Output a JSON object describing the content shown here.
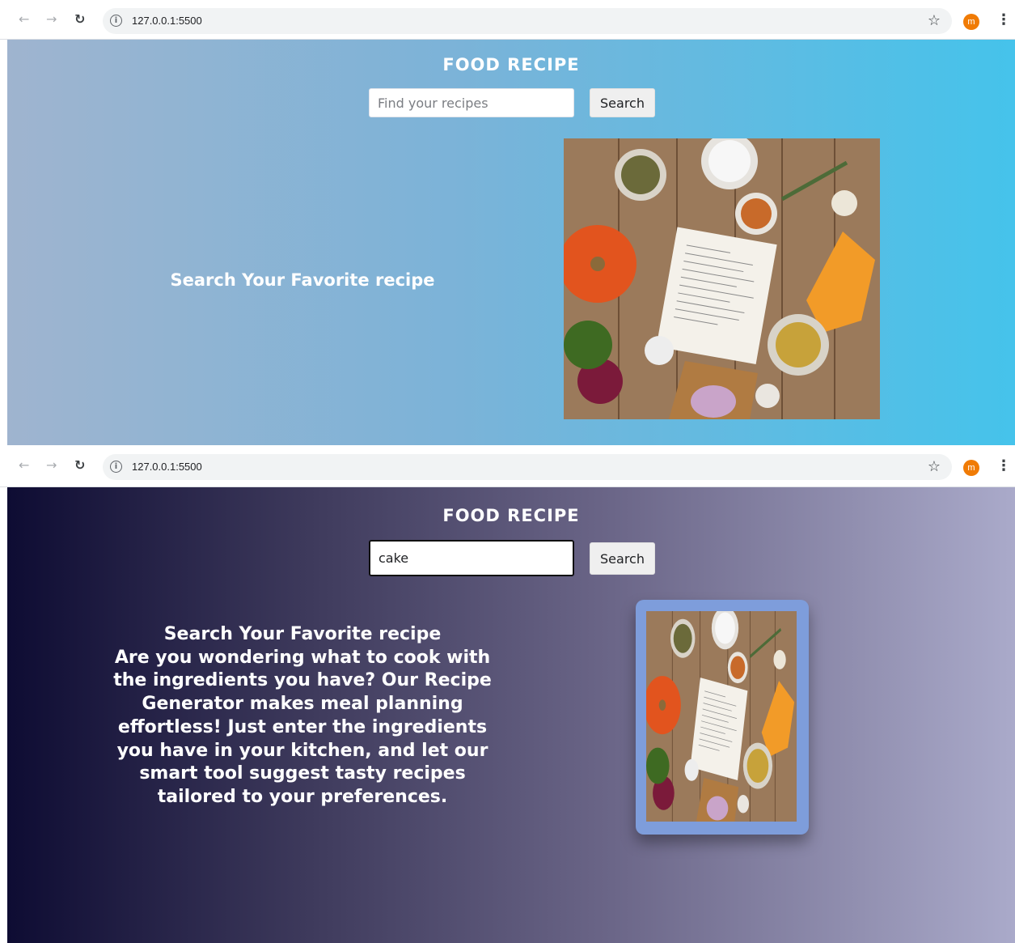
{
  "browser": {
    "url": "127.0.0.1:5500",
    "avatar_letter": "m",
    "accent_color": "#f07b05"
  },
  "screen_1": {
    "title": "FOOD RECIPE",
    "search": {
      "placeholder": "Find your recipes",
      "value": ""
    },
    "search_button": "Search",
    "heading": "Search Your Favorite recipe",
    "background_colors": [
      "#9fb4cf",
      "#45c3eb"
    ]
  },
  "screen_2": {
    "title": "FOOD RECIPE",
    "search": {
      "placeholder": "Find your recipes",
      "value": "cake"
    },
    "search_button": "Search",
    "heading": "Search Your Favorite recipe",
    "description": "Are you wondering what to cook with the ingredients you have? Our Recipe Generator makes meal planning effortless! Just enter the ingredients you have in your kitchen, and let our smart tool suggest tasty recipes tailored to your preferences.",
    "background_colors": [
      "#0e0c33",
      "#aaaaca"
    ],
    "image_frame_color": "#7e9ddb"
  }
}
